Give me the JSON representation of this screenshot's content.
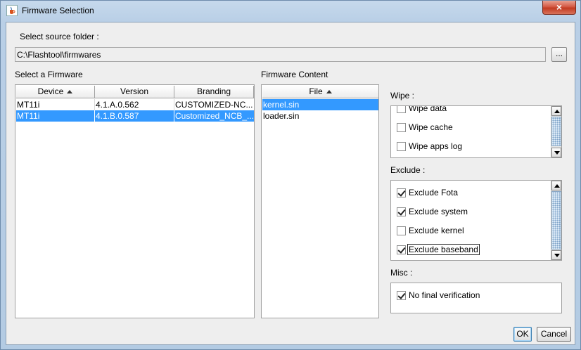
{
  "window": {
    "title": "Firmware Selection",
    "close_label": "×"
  },
  "source": {
    "label": "Select source folder :",
    "path": "C:\\Flashtool\\firmwares",
    "browse_label": "..."
  },
  "firmware_table": {
    "label": "Select a Firmware",
    "columns": [
      "Device",
      "Version",
      "Branding"
    ],
    "rows": [
      {
        "device": "MT11i",
        "version": "4.1.A.0.562",
        "branding": "CUSTOMIZED-NC...",
        "selected": false
      },
      {
        "device": "MT11i",
        "version": "4.1.B.0.587",
        "branding": "Customized_NCB_...",
        "selected": true
      }
    ]
  },
  "content_table": {
    "label": "Firmware Content",
    "column": "File",
    "rows": [
      {
        "file": "kernel.sin",
        "selected": true
      },
      {
        "file": "loader.sin",
        "selected": false
      }
    ]
  },
  "wipe": {
    "label": "Wipe :",
    "items": [
      {
        "label": "Wipe data",
        "checked": false
      },
      {
        "label": "Wipe cache",
        "checked": false
      },
      {
        "label": "Wipe apps log",
        "checked": false
      }
    ]
  },
  "exclude": {
    "label": "Exclude :",
    "items": [
      {
        "label": "Exclude Fota",
        "checked": true
      },
      {
        "label": "Exclude system",
        "checked": true
      },
      {
        "label": "Exclude kernel",
        "checked": false
      },
      {
        "label": "Exclude baseband",
        "checked": true
      }
    ]
  },
  "misc": {
    "label": "Misc :",
    "items": [
      {
        "label": "No final verification",
        "checked": true
      }
    ]
  },
  "buttons": {
    "ok": "OK",
    "cancel": "Cancel"
  },
  "colors": {
    "selection": "#3399ff",
    "dialog_bg": "#eeeeee",
    "close_button": "#c23b22"
  }
}
